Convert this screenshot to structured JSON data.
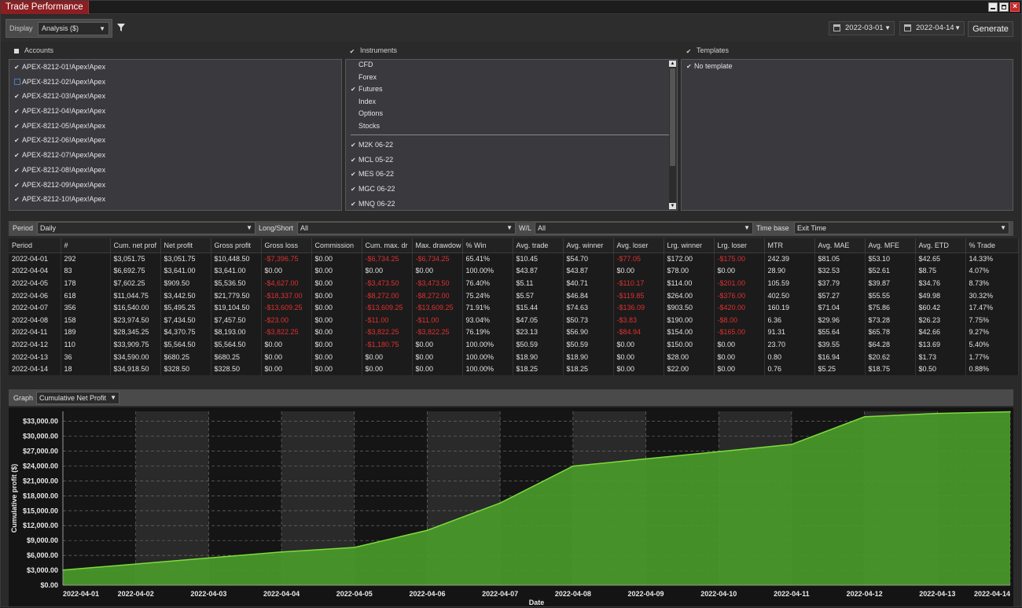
{
  "window": {
    "title": "Trade Performance"
  },
  "toolbar": {
    "display_label": "Display",
    "display_value": "Analysis ($)",
    "date_from": "2022-03-01",
    "date_to": "2022-04-14",
    "generate_label": "Generate"
  },
  "accounts": {
    "title": "Accounts",
    "items": [
      {
        "label": "APEX-8212-01!Apex!Apex",
        "checked": true
      },
      {
        "label": "APEX-8212-02!Apex!Apex",
        "checked": false
      },
      {
        "label": "APEX-8212-03!Apex!Apex",
        "checked": true
      },
      {
        "label": "APEX-8212-04!Apex!Apex",
        "checked": true
      },
      {
        "label": "APEX-8212-05!Apex!Apex",
        "checked": true
      },
      {
        "label": "APEX-8212-06!Apex!Apex",
        "checked": true
      },
      {
        "label": "APEX-8212-07!Apex!Apex",
        "checked": true
      },
      {
        "label": "APEX-8212-08!Apex!Apex",
        "checked": true
      },
      {
        "label": "APEX-8212-09!Apex!Apex",
        "checked": true
      },
      {
        "label": "APEX-8212-10!Apex!Apex",
        "checked": true
      }
    ]
  },
  "instruments": {
    "title": "Instruments",
    "types": [
      {
        "label": "CFD",
        "checked": false
      },
      {
        "label": "Forex",
        "checked": false
      },
      {
        "label": "Futures",
        "checked": true
      },
      {
        "label": "Index",
        "checked": false
      },
      {
        "label": "Options",
        "checked": false
      },
      {
        "label": "Stocks",
        "checked": false
      }
    ],
    "items": [
      {
        "label": "M2K 06-22",
        "checked": true
      },
      {
        "label": "MCL 05-22",
        "checked": true
      },
      {
        "label": "MES 06-22",
        "checked": true
      },
      {
        "label": "MGC 06-22",
        "checked": true
      },
      {
        "label": "MNQ 06-22",
        "checked": true
      }
    ]
  },
  "templates": {
    "title": "Templates",
    "items": [
      {
        "label": "No template",
        "checked": true
      }
    ]
  },
  "filters": {
    "period_label": "Period",
    "period_value": "Daily",
    "longshort_label": "Long/Short",
    "longshort_value": "All",
    "wl_label": "W/L",
    "wl_value": "All",
    "timebase_label": "Time base",
    "timebase_value": "Exit Time"
  },
  "table": {
    "columns": [
      "Period",
      "#",
      "Cum. net prof",
      "Net profit",
      "Gross profit",
      "Gross loss",
      "Commission",
      "Cum. max. dr",
      "Max. drawdow",
      "% Win",
      "Avg. trade",
      "Avg. winner",
      "Avg. loser",
      "Lrg. winner",
      "Lrg. loser",
      "MTR",
      "Avg. MAE",
      "Avg. MFE",
      "Avg. ETD",
      "% Trade"
    ],
    "rows": [
      [
        "2022-04-01",
        "292",
        "$3,051.75",
        "$3,051.75",
        "$10,448.50",
        "-$7,396.75",
        "$0.00",
        "-$6,734.25",
        "-$6,734.25",
        "65.41%",
        "$10.45",
        "$54.70",
        "-$77.05",
        "$172.00",
        "-$175.00",
        "242.39",
        "$81.05",
        "$53.10",
        "$42.65",
        "14.33%"
      ],
      [
        "2022-04-04",
        "83",
        "$6,692.75",
        "$3,641.00",
        "$3,641.00",
        "$0.00",
        "$0.00",
        "$0.00",
        "$0.00",
        "100.00%",
        "$43.87",
        "$43.87",
        "$0.00",
        "$78.00",
        "$0.00",
        "28.90",
        "$32.53",
        "$52.61",
        "$8.75",
        "4.07%"
      ],
      [
        "2022-04-05",
        "178",
        "$7,602.25",
        "$909.50",
        "$5,536.50",
        "-$4,627.00",
        "$0.00",
        "-$3,473.50",
        "-$3,473.50",
        "76.40%",
        "$5.11",
        "$40.71",
        "-$110.17",
        "$114.00",
        "-$201.00",
        "105.59",
        "$37.79",
        "$39.87",
        "$34.76",
        "8.73%"
      ],
      [
        "2022-04-06",
        "618",
        "$11,044.75",
        "$3,442.50",
        "$21,779.50",
        "-$18,337.00",
        "$0.00",
        "-$8,272.00",
        "-$8,272.00",
        "75.24%",
        "$5.57",
        "$46.84",
        "-$119.85",
        "$264.00",
        "-$376.00",
        "402.50",
        "$57.27",
        "$55.55",
        "$49.98",
        "30.32%"
      ],
      [
        "2022-04-07",
        "356",
        "$16,540.00",
        "$5,495.25",
        "$19,104.50",
        "-$13,609.25",
        "$0.00",
        "-$13,609.25",
        "-$13,609.25",
        "71.91%",
        "$15.44",
        "$74.63",
        "-$136.09",
        "$903.50",
        "-$420.00",
        "160.19",
        "$71.04",
        "$75.86",
        "$60.42",
        "17.47%"
      ],
      [
        "2022-04-08",
        "158",
        "$23,974.50",
        "$7,434.50",
        "$7,457.50",
        "-$23.00",
        "$0.00",
        "-$11.00",
        "-$11.00",
        "93.04%",
        "$47.05",
        "$50.73",
        "-$3.83",
        "$190.00",
        "-$8.00",
        "6.36",
        "$29.96",
        "$73.28",
        "$26.23",
        "7.75%"
      ],
      [
        "2022-04-11",
        "189",
        "$28,345.25",
        "$4,370.75",
        "$8,193.00",
        "-$3,822.25",
        "$0.00",
        "-$3,822.25",
        "-$3,822.25",
        "76.19%",
        "$23.13",
        "$56.90",
        "-$84.94",
        "$154.00",
        "-$165.00",
        "91.31",
        "$55.64",
        "$65.78",
        "$42.66",
        "9.27%"
      ],
      [
        "2022-04-12",
        "110",
        "$33,909.75",
        "$5,564.50",
        "$5,564.50",
        "$0.00",
        "$0.00",
        "-$1,180.75",
        "$0.00",
        "100.00%",
        "$50.59",
        "$50.59",
        "$0.00",
        "$150.00",
        "$0.00",
        "23.70",
        "$39.55",
        "$64.28",
        "$13.69",
        "5.40%"
      ],
      [
        "2022-04-13",
        "36",
        "$34,590.00",
        "$680.25",
        "$680.25",
        "$0.00",
        "$0.00",
        "$0.00",
        "$0.00",
        "100.00%",
        "$18.90",
        "$18.90",
        "$0.00",
        "$28.00",
        "$0.00",
        "0.80",
        "$16.94",
        "$20.62",
        "$1.73",
        "1.77%"
      ],
      [
        "2022-04-14",
        "18",
        "$34,918.50",
        "$328.50",
        "$328.50",
        "$0.00",
        "$0.00",
        "$0.00",
        "$0.00",
        "100.00%",
        "$18.25",
        "$18.25",
        "$0.00",
        "$22.00",
        "$0.00",
        "0.76",
        "$5.25",
        "$18.75",
        "$0.50",
        "0.88%"
      ]
    ]
  },
  "graph": {
    "label": "Graph",
    "value": "Cumulative Net Profit"
  },
  "colors": {
    "accent_red": "#8a1e22",
    "negative": "#e03030",
    "area_fill": "#4a9a2a",
    "area_line": "#7ddc3c"
  },
  "chart_data": {
    "type": "area",
    "x": [
      "2022-04-01",
      "2022-04-02",
      "2022-04-03",
      "2022-04-04",
      "2022-04-05",
      "2022-04-06",
      "2022-04-07",
      "2022-04-08",
      "2022-04-09",
      "2022-04-10",
      "2022-04-11",
      "2022-04-12",
      "2022-04-13",
      "2022-04-14"
    ],
    "series": [
      {
        "values": [
          3051.75,
          4264,
          5478,
          6692.75,
          7602.25,
          11044.75,
          16540.0,
          23974.5,
          25431.42,
          26888.33,
          28345.25,
          33909.75,
          34590.0,
          34918.5
        ]
      }
    ],
    "xlabel": "Date",
    "ylabel": "Cumulative profit ($)",
    "yticks": [
      0,
      3000,
      6000,
      9000,
      12000,
      15000,
      18000,
      21000,
      24000,
      27000,
      30000,
      33000
    ],
    "ytick_labels": [
      "$0.00",
      "$3,000.00",
      "$6,000.00",
      "$9,000.00",
      "$12,000.00",
      "$15,000.00",
      "$18,000.00",
      "$21,000.00",
      "$24,000.00",
      "$27,000.00",
      "$30,000.00",
      "$33,000.00"
    ],
    "ylim": [
      0,
      35000
    ],
    "grid": true
  }
}
